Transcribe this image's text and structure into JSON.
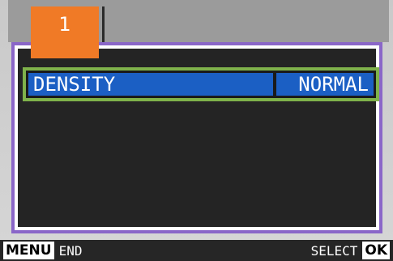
{
  "tab": {
    "label": "1",
    "color": "#f07a26"
  },
  "menu": {
    "items": [
      {
        "label": "DENSITY",
        "value": "NORMAL",
        "selected": true
      }
    ]
  },
  "footer": {
    "menu_key": "MENU",
    "menu_action": "END",
    "select_action": "SELECT",
    "ok_key": "OK"
  },
  "colors": {
    "highlight": "#1b5fc4",
    "selection_border": "#7fb24b",
    "panel_border": "#8a66c8"
  }
}
